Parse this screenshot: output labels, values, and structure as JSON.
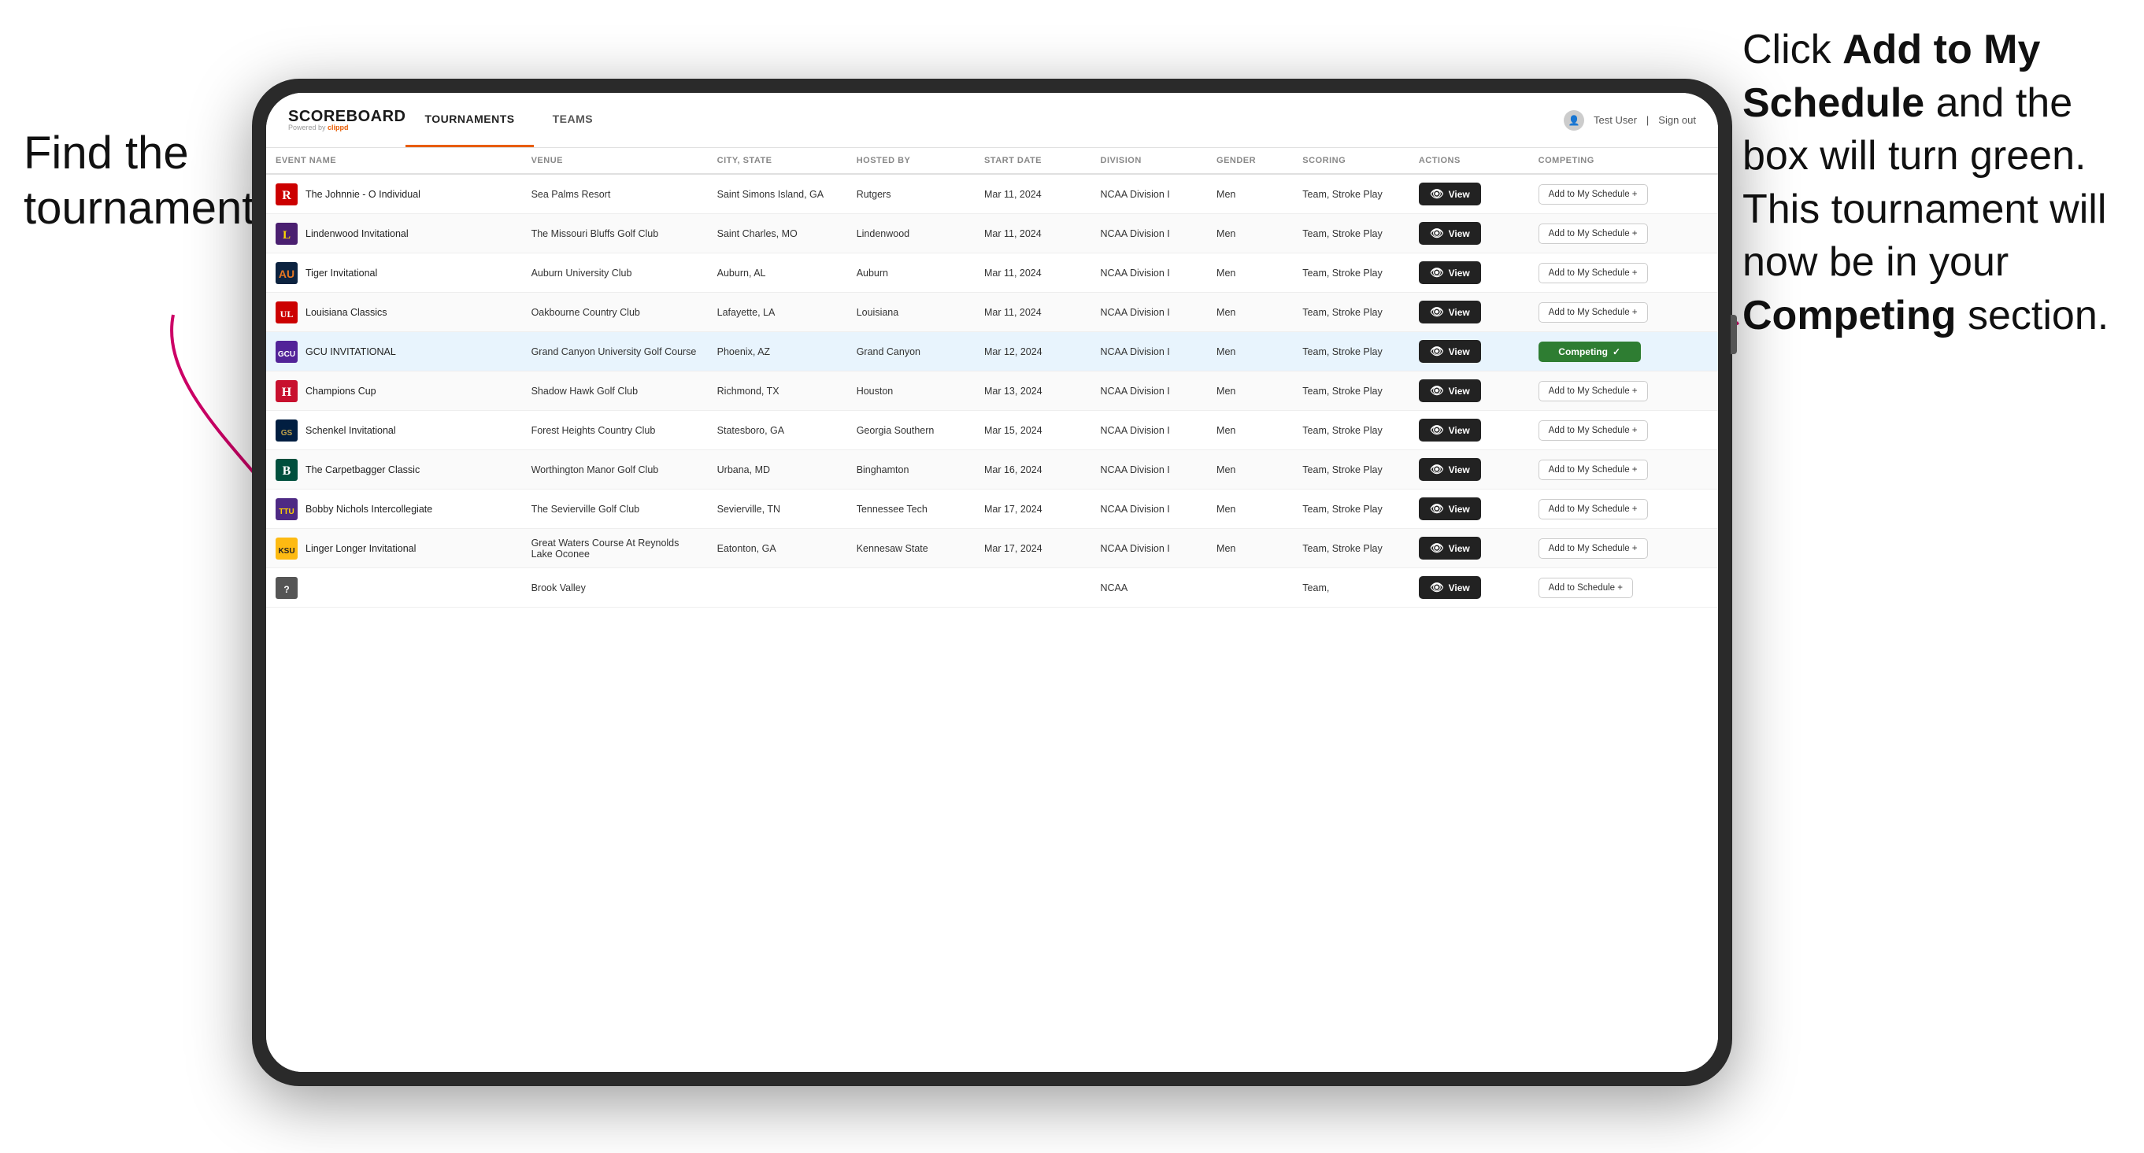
{
  "annotations": {
    "left": "Find the tournament.",
    "right_part1": "Click ",
    "right_bold1": "Add to My Schedule",
    "right_part2": " and the box will turn green. This tournament will now be in your ",
    "right_bold2": "Competing",
    "right_part3": " section."
  },
  "navbar": {
    "brand": "SCOREBOARD",
    "powered_by": "Powered by ",
    "powered_by_brand": "clippd",
    "tabs": [
      {
        "label": "TOURNAMENTS",
        "active": true
      },
      {
        "label": "TEAMS",
        "active": false
      }
    ],
    "user": "Test User",
    "sign_out": "Sign out"
  },
  "table": {
    "columns": [
      "EVENT NAME",
      "VENUE",
      "CITY, STATE",
      "HOSTED BY",
      "START DATE",
      "DIVISION",
      "GENDER",
      "SCORING",
      "ACTIONS",
      "COMPETING"
    ],
    "rows": [
      {
        "logo": "🅁",
        "logo_color": "#cc0000",
        "event": "The Johnnie - O Individual",
        "venue": "Sea Palms Resort",
        "city": "Saint Simons Island, GA",
        "hosted": "Rutgers",
        "date": "Mar 11, 2024",
        "division": "NCAA Division I",
        "gender": "Men",
        "scoring": "Team, Stroke Play",
        "action": "View",
        "competing_label": "Add to My Schedule +",
        "competing_type": "add",
        "highlighted": false
      },
      {
        "logo": "🦁",
        "logo_color": "#003366",
        "event": "Lindenwood Invitational",
        "venue": "The Missouri Bluffs Golf Club",
        "city": "Saint Charles, MO",
        "hosted": "Lindenwood",
        "date": "Mar 11, 2024",
        "division": "NCAA Division I",
        "gender": "Men",
        "scoring": "Team, Stroke Play",
        "action": "View",
        "competing_label": "Add to My Schedule +",
        "competing_type": "add",
        "highlighted": false
      },
      {
        "logo": "🐯",
        "logo_color": "#ff6600",
        "event": "Tiger Invitational",
        "venue": "Auburn University Club",
        "city": "Auburn, AL",
        "hosted": "Auburn",
        "date": "Mar 11, 2024",
        "division": "NCAA Division I",
        "gender": "Men",
        "scoring": "Team, Stroke Play",
        "action": "View",
        "competing_label": "Add to My Schedule +",
        "competing_type": "add",
        "highlighted": false
      },
      {
        "logo": "⚜",
        "logo_color": "#cc0000",
        "event": "Louisiana Classics",
        "venue": "Oakbourne Country Club",
        "city": "Lafayette, LA",
        "hosted": "Louisiana",
        "date": "Mar 11, 2024",
        "division": "NCAA Division I",
        "gender": "Men",
        "scoring": "Team, Stroke Play",
        "action": "View",
        "competing_label": "Add to My Schedule +",
        "competing_type": "add",
        "highlighted": false
      },
      {
        "logo": "⛰",
        "logo_color": "#4a1f8b",
        "event": "GCU INVITATIONAL",
        "venue": "Grand Canyon University Golf Course",
        "city": "Phoenix, AZ",
        "hosted": "Grand Canyon",
        "date": "Mar 12, 2024",
        "division": "NCAA Division I",
        "gender": "Men",
        "scoring": "Team, Stroke Play",
        "action": "View",
        "competing_label": "Competing ✓",
        "competing_type": "competing",
        "highlighted": true
      },
      {
        "logo": "🏆",
        "logo_color": "#cc0000",
        "event": "Champions Cup",
        "venue": "Shadow Hawk Golf Club",
        "city": "Richmond, TX",
        "hosted": "Houston",
        "date": "Mar 13, 2024",
        "division": "NCAA Division I",
        "gender": "Men",
        "scoring": "Team, Stroke Play",
        "action": "View",
        "competing_label": "Add to My Schedule +",
        "competing_type": "add",
        "highlighted": false
      },
      {
        "logo": "🦅",
        "logo_color": "#006633",
        "event": "Schenkel Invitational",
        "venue": "Forest Heights Country Club",
        "city": "Statesboro, GA",
        "hosted": "Georgia Southern",
        "date": "Mar 15, 2024",
        "division": "NCAA Division I",
        "gender": "Men",
        "scoring": "Team, Stroke Play",
        "action": "View",
        "competing_label": "Add to My Schedule +",
        "competing_type": "add",
        "highlighted": false
      },
      {
        "logo": "🅱",
        "logo_color": "#003399",
        "event": "The Carpetbagger Classic",
        "venue": "Worthington Manor Golf Club",
        "city": "Urbana, MD",
        "hosted": "Binghamton",
        "date": "Mar 16, 2024",
        "division": "NCAA Division I",
        "gender": "Men",
        "scoring": "Team, Stroke Play",
        "action": "View",
        "competing_label": "Add to My Schedule +",
        "competing_type": "add",
        "highlighted": false
      },
      {
        "logo": "🦬",
        "logo_color": "#993300",
        "event": "Bobby Nichols Intercollegiate",
        "venue": "The Sevierville Golf Club",
        "city": "Sevierville, TN",
        "hosted": "Tennessee Tech",
        "date": "Mar 17, 2024",
        "division": "NCAA Division I",
        "gender": "Men",
        "scoring": "Team, Stroke Play",
        "action": "View",
        "competing_label": "Add to My Schedule +",
        "competing_type": "add",
        "highlighted": false
      },
      {
        "logo": "🦉",
        "logo_color": "#cc6600",
        "event": "Linger Longer Invitational",
        "venue": "Great Waters Course At Reynolds Lake Oconee",
        "city": "Eatonton, GA",
        "hosted": "Kennesaw State",
        "date": "Mar 17, 2024",
        "division": "NCAA Division I",
        "gender": "Men",
        "scoring": "Team, Stroke Play",
        "action": "View",
        "competing_label": "Add to My Schedule +",
        "competing_type": "add",
        "highlighted": false
      },
      {
        "logo": "🐻",
        "logo_color": "#333333",
        "event": "",
        "venue": "Brook Valley",
        "city": "",
        "hosted": "",
        "date": "",
        "division": "NCAA",
        "gender": "",
        "scoring": "Team,",
        "action": "View",
        "competing_label": "Add to Schedule +",
        "competing_type": "add",
        "highlighted": false
      }
    ]
  }
}
